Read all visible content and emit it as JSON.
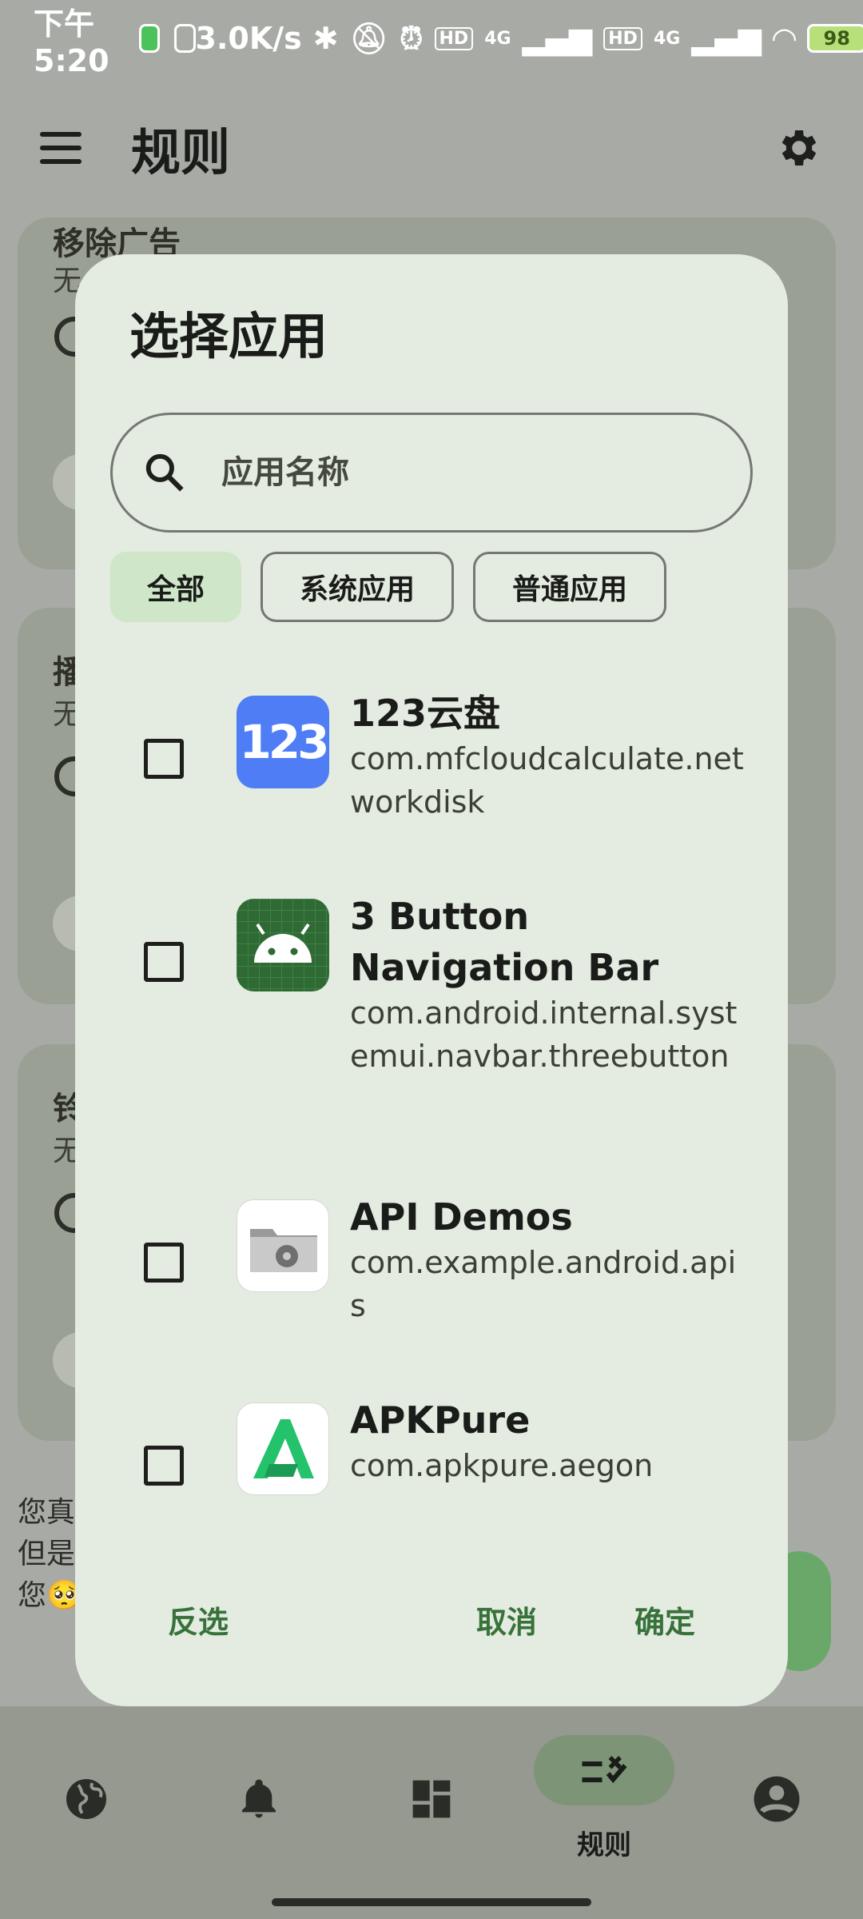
{
  "status_bar": {
    "time": "下午5:20",
    "network_speed": "3.0K/s",
    "signal1": "4G",
    "signal2": "4G",
    "hd1": "HD",
    "hd2": "HD",
    "battery": "98"
  },
  "app_bar": {
    "title": "规则",
    "menu_icon": "menu-icon",
    "settings_icon": "gear-icon"
  },
  "background_cards": [
    {
      "title": "移除广告",
      "subtitle": "无"
    },
    {
      "title": "播",
      "subtitle": "无"
    },
    {
      "title": "铃",
      "subtitle": "无"
    }
  ],
  "background_note": [
    "您真",
    "但是",
    "您🥺"
  ],
  "dialog": {
    "title": "选择应用",
    "search_placeholder": "应用名称",
    "chips": [
      {
        "label": "全部",
        "selected": true
      },
      {
        "label": "系统应用",
        "selected": false
      },
      {
        "label": "普通应用",
        "selected": false
      }
    ],
    "apps": [
      {
        "name": "123云盘",
        "package": "com.mfcloudcalculate.networkdisk",
        "checked": false,
        "icon": "123-cloud-icon"
      },
      {
        "name": "3 Button Navigation Bar",
        "package": "com.android.internal.systemui.navbar.threebutton",
        "checked": false,
        "icon": "android-icon"
      },
      {
        "name": "API Demos",
        "package": "com.example.android.apis",
        "checked": false,
        "icon": "folder-gear-icon"
      },
      {
        "name": "APKPure",
        "package": "com.apkpure.aegon",
        "checked": false,
        "icon": "apkpure-icon"
      }
    ],
    "buttons": {
      "invert": "反选",
      "cancel": "取消",
      "confirm": "确定"
    }
  },
  "bottom_nav": {
    "items": [
      {
        "icon": "globe-icon"
      },
      {
        "icon": "bell-icon"
      },
      {
        "icon": "dashboard-icon"
      },
      {
        "icon": "rules-icon",
        "label": "规则",
        "active": true
      },
      {
        "icon": "account-icon"
      }
    ]
  },
  "colors": {
    "accent": "#37723a",
    "dialog_bg": "#e4ebe0",
    "chip_selected": "#cfe6c8"
  }
}
